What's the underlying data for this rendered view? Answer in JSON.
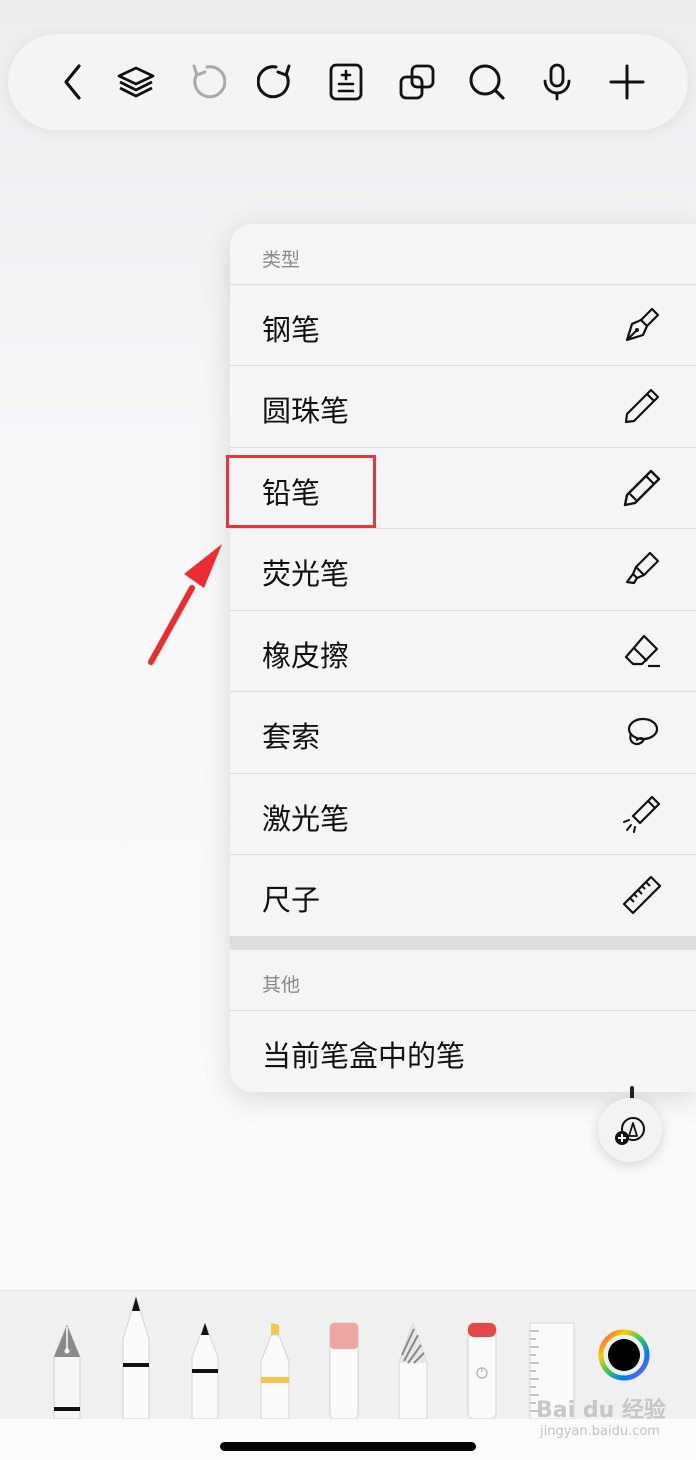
{
  "toolbar": {
    "icons": [
      "chevron-left-icon",
      "layers-icon",
      "undo-icon",
      "redo-icon",
      "page-adjust-icon",
      "duplicate-icon",
      "search-icon",
      "microphone-icon",
      "plus-icon"
    ]
  },
  "menu": {
    "section_type_label": "类型",
    "items": [
      {
        "label": "钢笔",
        "icon": "fountain-pen-icon"
      },
      {
        "label": "圆珠笔",
        "icon": "ballpoint-pen-icon"
      },
      {
        "label": "铅笔",
        "icon": "pencil-icon"
      },
      {
        "label": "荧光笔",
        "icon": "highlighter-icon"
      },
      {
        "label": "橡皮擦",
        "icon": "eraser-icon"
      },
      {
        "label": "套索",
        "icon": "lasso-icon"
      },
      {
        "label": "激光笔",
        "icon": "laser-pointer-icon"
      },
      {
        "label": "尺子",
        "icon": "ruler-icon"
      }
    ],
    "section_other_label": "其他",
    "other_items": [
      {
        "label": "当前笔盒中的笔"
      }
    ]
  },
  "annotation": {
    "highlight_color": "#e0383e",
    "highlighted_item": "铅笔"
  },
  "tray": {
    "tools": [
      "fountain-pen-tool",
      "pen-tool",
      "pencil-tool",
      "highlighter-tool",
      "eraser-tool",
      "lasso-tool",
      "laser-pointer-tool",
      "ruler-tool",
      "color-picker"
    ],
    "selected_color": "#000000"
  },
  "watermark": {
    "logo": "Bai du 经验",
    "url": "jingyan.baidu.com"
  }
}
